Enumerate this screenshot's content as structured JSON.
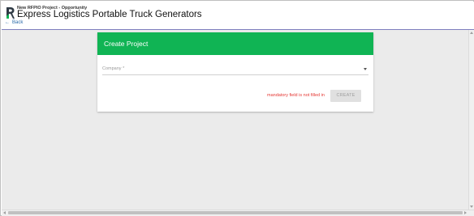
{
  "header": {
    "subtitle": "New RFPIO Project - Opportunity",
    "title": "Express Logistics Portable Truck Generators",
    "back_label": "Back",
    "logo_icon": "rfpio-logo-icon",
    "back_icon": "arrow-left-icon"
  },
  "card": {
    "title": "Create Project",
    "company_field": {
      "placeholder": "Company *",
      "value": "",
      "icon": "chevron-down-icon"
    },
    "error_message": "mandatory field is not filled in",
    "create_label": "CREATE",
    "create_enabled": false
  },
  "colors": {
    "accent": "#10b454",
    "error": "#e53935",
    "link": "#2a6aa8",
    "background": "#ebebeb"
  }
}
